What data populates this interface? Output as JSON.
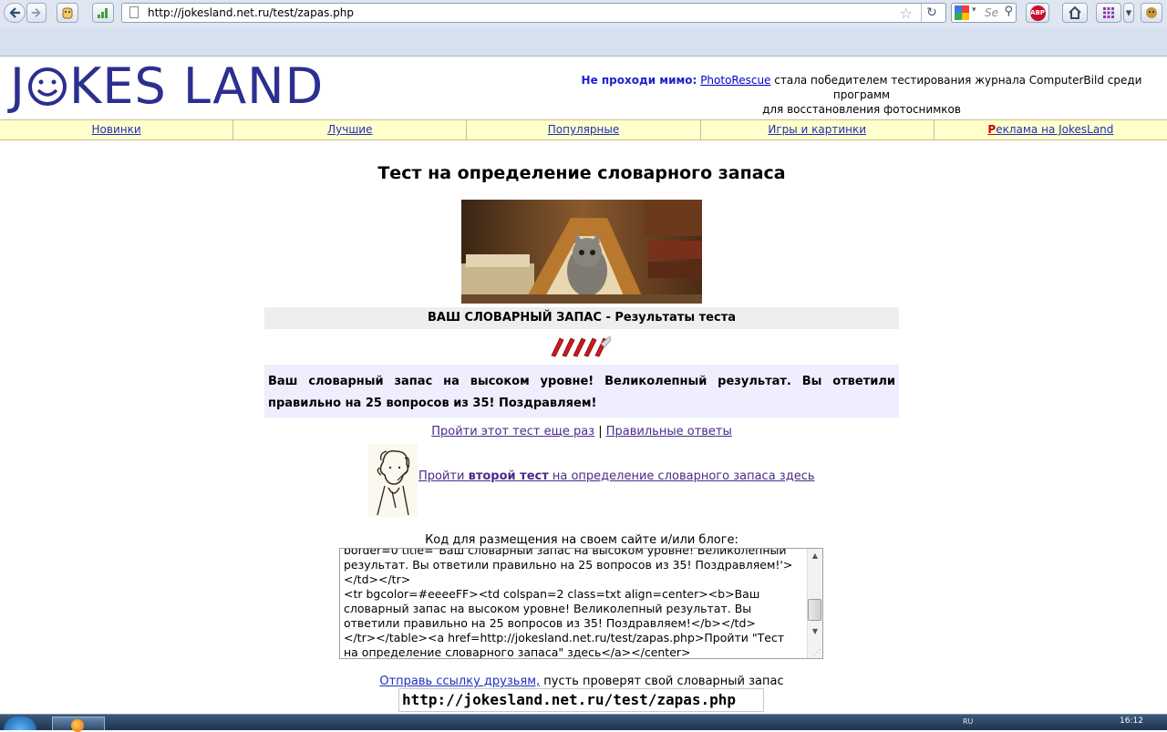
{
  "browser": {
    "url": "http://jokesland.net.ru/test/zapas.php",
    "search_placeholder": "Se"
  },
  "site": {
    "logo_before": "J",
    "logo_after": "KES LAND",
    "promo_label": "Не проходи мимо:",
    "promo_link": "PhotoRescue",
    "promo_line1_rest": " стала победителем тестирования журнала ComputerBild среди программ",
    "promo_line2": "для восстановления фотоснимков"
  },
  "nav": {
    "items": [
      "Новинки",
      "Лучшие",
      "Популярные",
      "Игры и картинки"
    ],
    "ads_first": "Р",
    "ads_rest": "еклама на JokesLand"
  },
  "test": {
    "title": "Тест на определение словарного запаса",
    "result_header": "ВАШ СЛОВАРНЫЙ ЗАПАС - Результаты теста",
    "rating_level": 5,
    "result_text": "Ваш словарный запас на высоком уровне! Великолепный результат. Вы ответили правильно на 25 вопросов из 35! Поздравляем!",
    "retake_link": "Пройти этот тест еще раз",
    "separator": " | ",
    "answers_link": "Правильные ответы",
    "second_prefix": "Пройти ",
    "second_bold": "второй тест",
    "second_suffix": " на определение словарного запаса здесь",
    "embed_label": "Код для размещения на своем сайте и/или блоге:",
    "embed_code": "border=0 title=\"Ваш словарный запас на высоком уровне! Великолепный результат. Вы ответили правильно на 25 вопросов из 35! Поздравляем!'>\n</td></tr>\n<tr bgcolor=#eeeeFF><td colspan=2 class=txt align=center><b>Ваш словарный запас на высоком уровне! Великолепный результат. Вы ответили правильно на 25 вопросов из 35! Поздравляем!</b></td>\n</tr></table><a href=http://jokesland.net.ru/test/zapas.php>Пройти \"Тест на определение словарного запаса\" здесь</a></center>",
    "share_link": "Отправь ссылку друзьям,",
    "share_rest": " пусть проверят свой словарный запас",
    "share_url": "http://jokesland.net.ru/test/zapas.php"
  },
  "taskbar": {
    "tray_text": "RU",
    "clock": "16:12"
  },
  "colors": {
    "logo": "#2b2f8f",
    "nav_bg": "#ffffcc",
    "result_bg": "#eeeeff",
    "header_bg": "#eeeeee",
    "visited_link": "#4a2a8a"
  }
}
